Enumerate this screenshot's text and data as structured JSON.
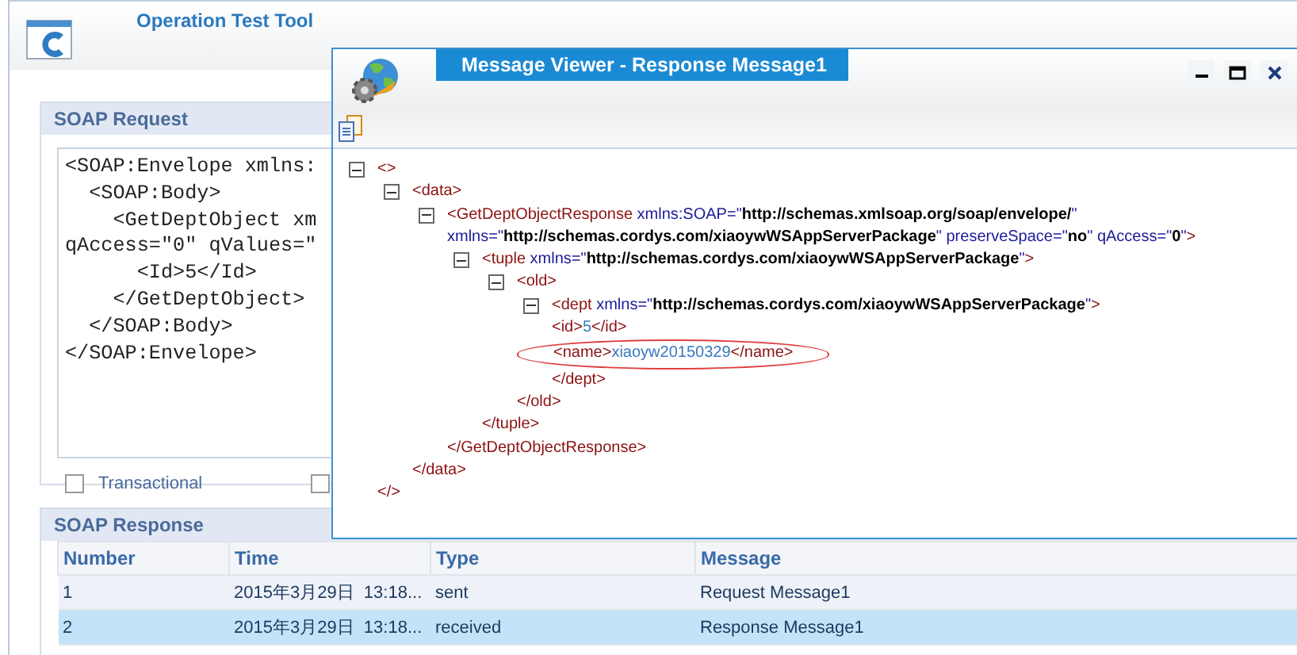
{
  "app": {
    "title": "Operation Test Tool"
  },
  "request": {
    "title": "SOAP Request",
    "code_lines": [
      "<SOAP:Envelope xmlns:",
      "  <SOAP:Body>",
      "    <GetDeptObject xm",
      "qAccess=\"0\" qValues=\"",
      "      <Id>5</Id>",
      "    </GetDeptObject>",
      "  </SOAP:Body>",
      "</SOAP:Envelope>"
    ],
    "options": [
      {
        "label": "Transactional",
        "checked": false
      },
      {
        "checked": false
      }
    ]
  },
  "response": {
    "title": "SOAP Response",
    "columns": [
      "Number",
      "Time",
      "Type",
      "Message"
    ],
    "rows": [
      {
        "cells": [
          "1",
          "2015年3月29日  13:18...",
          "sent",
          "Request Message1"
        ],
        "selected": false
      },
      {
        "cells": [
          "2",
          "2015年3月29日  13:18...",
          "received",
          "Response Message1"
        ],
        "selected": true
      }
    ]
  },
  "viewer": {
    "title": "Message Viewer - Response Message1",
    "tree": {
      "expanded": true,
      "open": [
        {
          "kind": "tag",
          "text": "<>"
        }
      ],
      "close": [
        {
          "kind": "tag",
          "text": "</>"
        }
      ],
      "children": [
        {
          "expanded": true,
          "open": [
            {
              "kind": "tag",
              "text": "<data>"
            }
          ],
          "close": [
            {
              "kind": "tag",
              "text": "</data>"
            }
          ],
          "children": [
            {
              "expanded": true,
              "open": [
                {
                  "kind": "tag",
                  "text": "<GetDeptObjectResponse"
                },
                {
                  "kind": "attr",
                  "text": " xmlns:SOAP=\""
                },
                {
                  "kind": "value",
                  "text": "http://schemas.xmlsoap.org/soap/envelope/"
                },
                {
                  "kind": "attr",
                  "text": "\" xmlns=\""
                },
                {
                  "kind": "value",
                  "text": "http://schemas.cordys.com/xiaoywWSAppServerPackage"
                },
                {
                  "kind": "attr",
                  "text": "\" preserveSpace=\""
                },
                {
                  "kind": "value",
                  "text": "no"
                },
                {
                  "kind": "attr",
                  "text": "\" qAccess=\""
                },
                {
                  "kind": "value",
                  "text": "0"
                },
                {
                  "kind": "attr",
                  "text": "\""
                },
                {
                  "kind": "tag",
                  "text": ">"
                }
              ],
              "close": [
                {
                  "kind": "tag",
                  "text": "</GetDeptObjectResponse>"
                }
              ],
              "children": [
                {
                  "expanded": true,
                  "open": [
                    {
                      "kind": "tag",
                      "text": "<tuple"
                    },
                    {
                      "kind": "attr",
                      "text": " xmlns=\""
                    },
                    {
                      "kind": "value",
                      "text": "http://schemas.cordys.com/xiaoywWSAppServerPackage"
                    },
                    {
                      "kind": "attr",
                      "text": "\""
                    },
                    {
                      "kind": "tag",
                      "text": ">"
                    }
                  ],
                  "close": [
                    {
                      "kind": "tag",
                      "text": "</tuple>"
                    }
                  ],
                  "children": [
                    {
                      "expanded": true,
                      "open": [
                        {
                          "kind": "tag",
                          "text": "<old>"
                        }
                      ],
                      "close": [
                        {
                          "kind": "tag",
                          "text": "</old>"
                        }
                      ],
                      "children": [
                        {
                          "expanded": true,
                          "open": [
                            {
                              "kind": "tag",
                              "text": "<dept"
                            },
                            {
                              "kind": "attr",
                              "text": " xmlns=\""
                            },
                            {
                              "kind": "value",
                              "text": "http://schemas.cordys.com/xiaoywWSAppServerPackage"
                            },
                            {
                              "kind": "attr",
                              "text": "\""
                            },
                            {
                              "kind": "tag",
                              "text": ">"
                            }
                          ],
                          "close": [
                            {
                              "kind": "tag",
                              "text": "</dept>"
                            }
                          ],
                          "children": [
                            {
                              "open": [
                                {
                                  "kind": "tag",
                                  "text": "<id>"
                                },
                                {
                                  "kind": "text",
                                  "text": "5"
                                },
                                {
                                  "kind": "tag",
                                  "text": "</id>"
                                }
                              ],
                              "circled": false
                            },
                            {
                              "open": [
                                {
                                  "kind": "tag",
                                  "text": "<name>"
                                },
                                {
                                  "kind": "text",
                                  "text": "xiaoyw20150329"
                                },
                                {
                                  "kind": "tag",
                                  "text": "</name>"
                                }
                              ],
                              "circled": true
                            }
                          ]
                        }
                      ]
                    }
                  ]
                }
              ]
            }
          ]
        }
      ]
    }
  }
}
